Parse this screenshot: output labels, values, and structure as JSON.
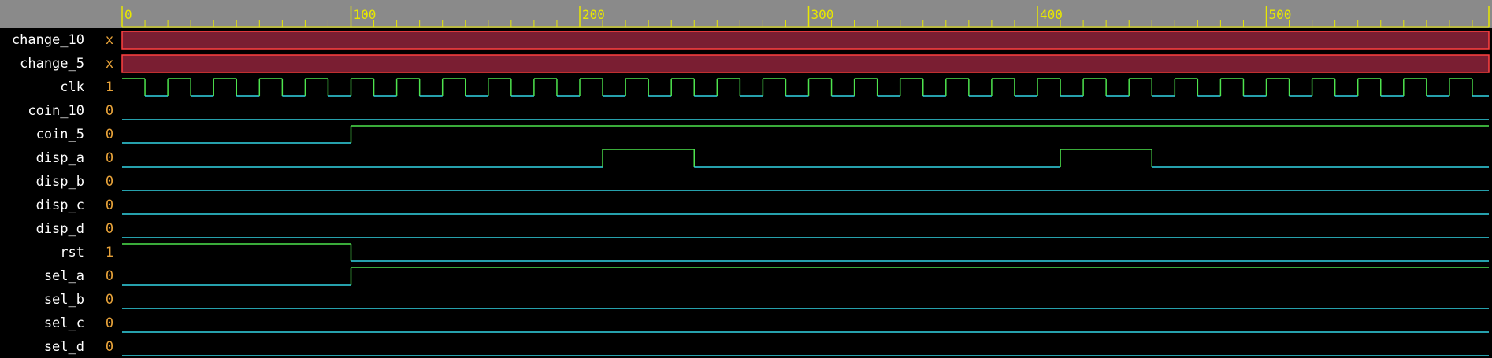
{
  "colors": {
    "background": "#000000",
    "ruler_bg": "#8a8a8a",
    "ruler_ticks": "#e8e800",
    "name_text": "#ffffff",
    "value_text": "#e8a33a",
    "wave_low": "#33d6e6",
    "wave_high": "#4ee44e",
    "bus_unknown_fill": "#7a1e32",
    "bus_unknown_edge": "#ff4040"
  },
  "ruler": {
    "labels": [
      "0",
      "100",
      "200",
      "300",
      "400",
      "500"
    ],
    "start": 0,
    "end": 600,
    "major_step": 100,
    "minor_step": 10
  },
  "signals": [
    {
      "name": "change_10",
      "value": "x",
      "kind": "bus_x"
    },
    {
      "name": "change_5",
      "value": "x",
      "kind": "bus_x"
    },
    {
      "name": "clk",
      "value": "1",
      "kind": "clock",
      "period": 20,
      "initial": 1,
      "first_toggle": 10
    },
    {
      "name": "coin_10",
      "value": "0",
      "kind": "bit",
      "initial": 0,
      "transitions": []
    },
    {
      "name": "coin_5",
      "value": "0",
      "kind": "bit",
      "initial": 0,
      "transitions": [
        100
      ]
    },
    {
      "name": "disp_a",
      "value": "0",
      "kind": "bit",
      "initial": 0,
      "transitions": [
        210,
        250,
        410,
        450
      ]
    },
    {
      "name": "disp_b",
      "value": "0",
      "kind": "bit",
      "initial": 0,
      "transitions": []
    },
    {
      "name": "disp_c",
      "value": "0",
      "kind": "bit",
      "initial": 0,
      "transitions": []
    },
    {
      "name": "disp_d",
      "value": "0",
      "kind": "bit",
      "initial": 0,
      "transitions": []
    },
    {
      "name": "rst",
      "value": "1",
      "kind": "bit",
      "initial": 1,
      "transitions": [
        100
      ]
    },
    {
      "name": "sel_a",
      "value": "0",
      "kind": "bit",
      "initial": 0,
      "transitions": [
        100
      ]
    },
    {
      "name": "sel_b",
      "value": "0",
      "kind": "bit",
      "initial": 0,
      "transitions": []
    },
    {
      "name": "sel_c",
      "value": "0",
      "kind": "bit",
      "initial": 0,
      "transitions": []
    },
    {
      "name": "sel_d",
      "value": "0",
      "kind": "bit",
      "initial": 0,
      "transitions": []
    }
  ]
}
